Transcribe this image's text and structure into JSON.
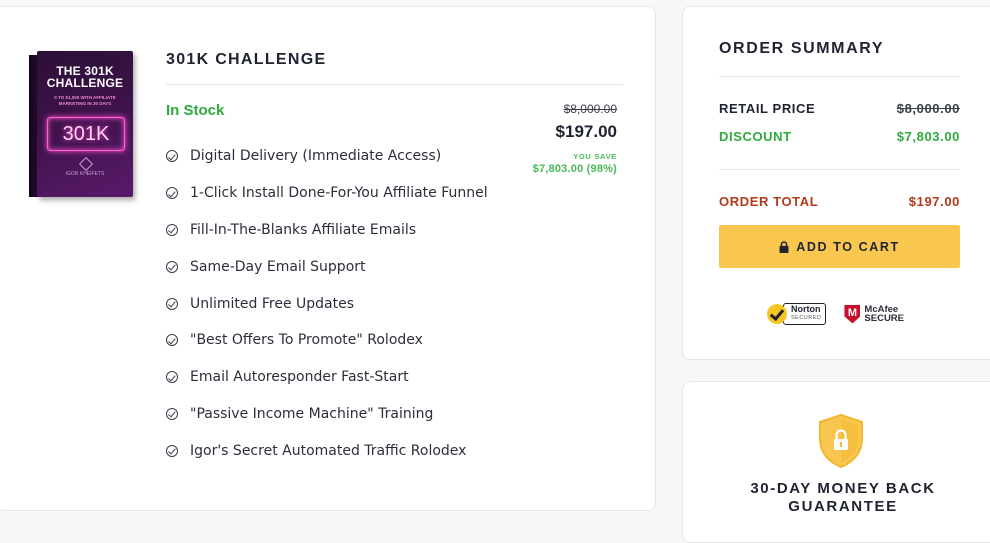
{
  "product": {
    "box_title": "THE 301K CHALLENGE",
    "box_subtitle": "0 TO $1,000 WITH AFFILIATE MARKETING IN 30 DAYS",
    "box_neon": "301K",
    "box_brand": "IGOR KHEIFETS",
    "title": "301K CHALLENGE",
    "stock": "In Stock",
    "old_price": "$8,000.00",
    "new_price": "$197.00",
    "you_save_label": "YOU SAVE",
    "save_amount": "$7,803.00 (98%)",
    "features": [
      "Digital Delivery (Immediate Access)",
      "1-Click Install Done-For-You Affiliate Funnel",
      "Fill-In-The-Blanks Affiliate Emails",
      "Same-Day Email Support",
      "Unlimited Free Updates",
      "\"Best Offers To Promote\" Rolodex",
      "Email Autoresponder Fast-Start",
      "\"Passive Income Machine\" Training",
      "Igor's Secret Automated Traffic Rolodex"
    ]
  },
  "summary": {
    "title": "ORDER SUMMARY",
    "retail_label": "RETAIL PRICE",
    "retail_value": "$8,000.00",
    "discount_label": "DISCOUNT",
    "discount_value": "$7,803.00",
    "total_label": "ORDER TOTAL",
    "total_value": "$197.00",
    "cart_button": "ADD TO CART",
    "norton_name": "Norton",
    "norton_sub": "SECURED",
    "mcafee_line1": "McAfee",
    "mcafee_line2": "SECURE"
  },
  "guarantee": {
    "line1": "30-DAY MONEY BACK",
    "line2": "GUARANTEE"
  },
  "colors": {
    "accent_green": "#2eaa3e",
    "total_red": "#b23a1d",
    "button_yellow": "#f9c74f"
  }
}
